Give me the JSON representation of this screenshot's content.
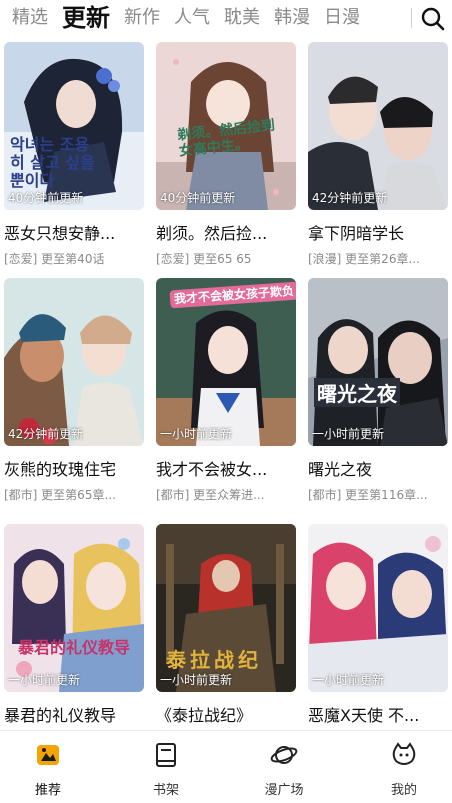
{
  "tabs": [
    "精选",
    "更新",
    "新作",
    "人气",
    "耽美",
    "韩漫",
    "日漫"
  ],
  "active_tab": "更新",
  "search_icon": "search-icon",
  "cards": [
    {
      "title": "恶女只想安静...",
      "meta": "[恋爱] 更至第40话",
      "time": "40分钟前更新"
    },
    {
      "title": "剃须。然后捡...",
      "meta": "[恋爱] 更至65 65",
      "time": "40分钟前更新"
    },
    {
      "title": "拿下阴暗学长",
      "meta": "[浪漫] 更至第26章...",
      "time": "42分钟前更新"
    },
    {
      "title": "灰熊的玫瑰住宅",
      "meta": "[都市] 更至第65章...",
      "time": "42分钟前更新"
    },
    {
      "title": "我才不会被女...",
      "meta": "[都市] 更至众筹进...",
      "time": "一小时前更新"
    },
    {
      "title": "曙光之夜",
      "meta": "[都市] 更至第116章...",
      "time": "一小时前更新"
    },
    {
      "title": "暴君的礼仪教导",
      "meta": "",
      "time": "一小时前更新"
    },
    {
      "title": "《泰拉战纪》",
      "meta": "",
      "time": "一小时前更新"
    },
    {
      "title": "恶魔X天使 不...",
      "meta": "",
      "time": "一小时前更新"
    }
  ],
  "cover_texts": {
    "c0": "악녀는 조용히 살고 싶을 뿐이다",
    "c1": "剃须。然后捡到女高中生。",
    "c4": "我才不会被女孩子欺负",
    "c5": "曙光之夜",
    "c6": "暴君的礼仪教导",
    "c7": "泰拉战纪"
  },
  "nav": [
    {
      "label": "推荐",
      "icon": "recommend-icon",
      "active": true
    },
    {
      "label": "书架",
      "icon": "bookshelf-icon",
      "active": false
    },
    {
      "label": "漫广场",
      "icon": "planet-icon",
      "active": false
    },
    {
      "label": "我的",
      "icon": "profile-icon",
      "active": false
    }
  ],
  "colors": {
    "accent": "#111111",
    "muted": "#8a8a8a"
  }
}
